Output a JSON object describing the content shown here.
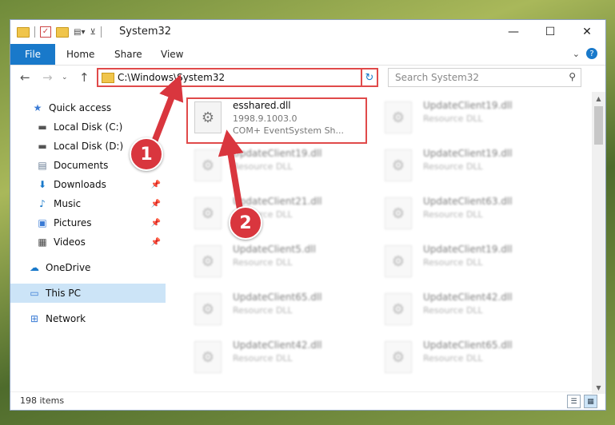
{
  "window": {
    "title": "System32",
    "controls": {
      "minimize": "—",
      "maximize": "☐",
      "close": "✕"
    }
  },
  "ribbon": {
    "tabs": [
      "File",
      "Home",
      "Share",
      "View"
    ],
    "help": "?"
  },
  "address": {
    "path": "C:\\Windows\\System32",
    "refresh": "↻"
  },
  "search": {
    "placeholder": "Search System32"
  },
  "sidebar": {
    "items": [
      {
        "label": "Quick access",
        "icon": "star-icon"
      },
      {
        "label": "Local Disk (C:)",
        "icon": "drive-icon"
      },
      {
        "label": "Local Disk (D:)",
        "icon": "drive-icon"
      },
      {
        "label": "Documents",
        "icon": "documents-icon"
      },
      {
        "label": "Downloads",
        "icon": "download-icon"
      },
      {
        "label": "Music",
        "icon": "music-icon"
      },
      {
        "label": "Pictures",
        "icon": "pictures-icon"
      },
      {
        "label": "Videos",
        "icon": "videos-icon"
      },
      {
        "label": "OneDrive",
        "icon": "cloud-icon"
      },
      {
        "label": "This PC",
        "icon": "computer-icon"
      },
      {
        "label": "Network",
        "icon": "network-icon"
      }
    ]
  },
  "files": [
    {
      "name": "esshared.dll",
      "line1": "1998.9.1003.0",
      "line2": "COM+ EventSystem Sh..."
    },
    {
      "name": "UpdateClient19.dll",
      "line1": "Resource DLL"
    },
    {
      "name": "UpdateClient19.dll",
      "line1": "Resource DLL"
    },
    {
      "name": "UpdateClient19.dll",
      "line1": "Resource DLL"
    },
    {
      "name": "UpdateClient21.dll",
      "line1": "Resource DLL"
    },
    {
      "name": "UpdateClient63.dll",
      "line1": "Resource DLL"
    },
    {
      "name": "UpdateClient5.dll",
      "line1": "Resource DLL"
    },
    {
      "name": "UpdateClient19.dll",
      "line1": "Resource DLL"
    },
    {
      "name": "UpdateClient65.dll",
      "line1": "Resource DLL"
    },
    {
      "name": "UpdateClient42.dll",
      "line1": "Resource DLL"
    },
    {
      "name": "UpdateClient42.dll",
      "line1": "Resource DLL"
    },
    {
      "name": "UpdateClient65.dll",
      "line1": "Resource DLL"
    }
  ],
  "status": {
    "items": "198 items"
  },
  "annotations": {
    "step1": "1",
    "step2": "2"
  },
  "colors": {
    "accent": "#1979ca",
    "highlight": "#e04a4a",
    "selected": "#cce4f7"
  }
}
